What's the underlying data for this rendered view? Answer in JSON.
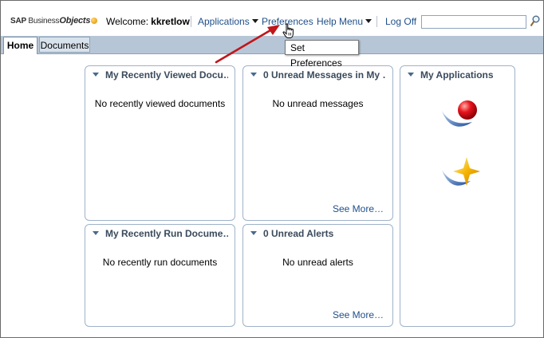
{
  "header": {
    "logo_text_1": "SAP ",
    "logo_text_2": "Business",
    "logo_text_3": "Objects",
    "welcome_label": "Welcome:",
    "username": "kkretlow",
    "nav": {
      "applications": "Applications",
      "preferences": "Preferences",
      "help_menu": "Help Menu",
      "log_off": "Log Off"
    },
    "search": {
      "value": "",
      "placeholder": ""
    }
  },
  "tabs": [
    {
      "label": "Home",
      "selected": true
    },
    {
      "label": "Documents",
      "selected": false
    }
  ],
  "tooltip": {
    "text": "Set Preferences"
  },
  "panels": {
    "recently_viewed": {
      "title": "My Recently Viewed Docu…",
      "message": "No recently viewed documents"
    },
    "unread_messages": {
      "title": "0 Unread Messages in My …",
      "message": "No unread messages",
      "see_more": "See More…"
    },
    "applications": {
      "title": "My Applications",
      "icons": [
        "red-ball-app-icon",
        "star-app-icon"
      ]
    },
    "recently_run": {
      "title": "My Recently Run Docume…",
      "message": "No recently run documents"
    },
    "unread_alerts": {
      "title": "0 Unread Alerts",
      "message": "No unread alerts",
      "see_more": "See More…"
    }
  },
  "colors": {
    "link": "#1f4f8a",
    "tabbar": "#b6c6d6",
    "panel_border": "#9fb3c8",
    "annotation_arrow": "#c0161c"
  }
}
